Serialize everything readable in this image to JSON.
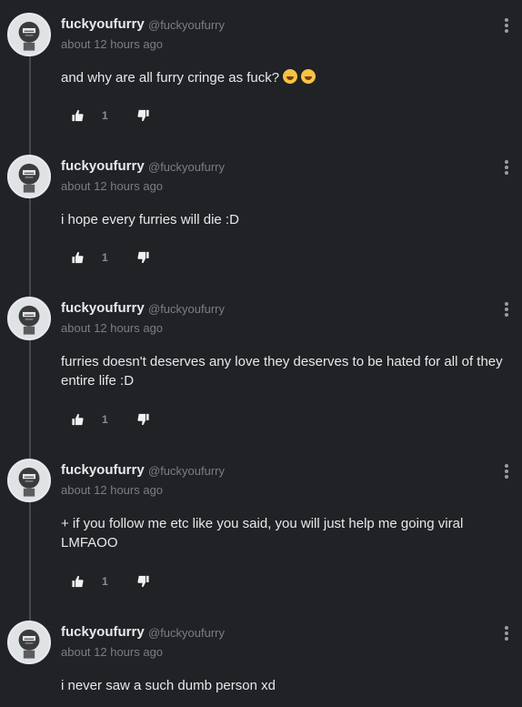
{
  "comments": [
    {
      "username": "fuckyoufurry",
      "handle": "@fuckyoufurry",
      "time": "about 12 hours ago",
      "text": "and why are all furry cringe as fuck?",
      "emoji_count": 2,
      "likes": "1"
    },
    {
      "username": "fuckyoufurry",
      "handle": "@fuckyoufurry",
      "time": "about 12 hours ago",
      "text": "i hope every furries will die :D",
      "emoji_count": 0,
      "likes": "1"
    },
    {
      "username": "fuckyoufurry",
      "handle": "@fuckyoufurry",
      "time": "about 12 hours ago",
      "text": "furries doesn't deserves any love they deserves to be hated for all of they entire life :D",
      "emoji_count": 0,
      "likes": "1"
    },
    {
      "username": "fuckyoufurry",
      "handle": "@fuckyoufurry",
      "time": "about 12 hours ago",
      "text": "+ if you follow me etc like you said, you will just help me going viral LMFAOO",
      "emoji_count": 0,
      "likes": "1"
    },
    {
      "username": "fuckyoufurry",
      "handle": "@fuckyoufurry",
      "time": "about 12 hours ago",
      "text": "i never saw a such dumb person xd",
      "emoji_count": 0,
      "likes": null
    }
  ],
  "colors": {
    "background": "#212226",
    "thread_line": "#47484d",
    "muted_text": "#7b7d82"
  },
  "icons": [
    "more-vertical-icon",
    "thumbs-up-icon",
    "thumbs-down-icon",
    "rolling-on-floor-laughing-emoji"
  ]
}
